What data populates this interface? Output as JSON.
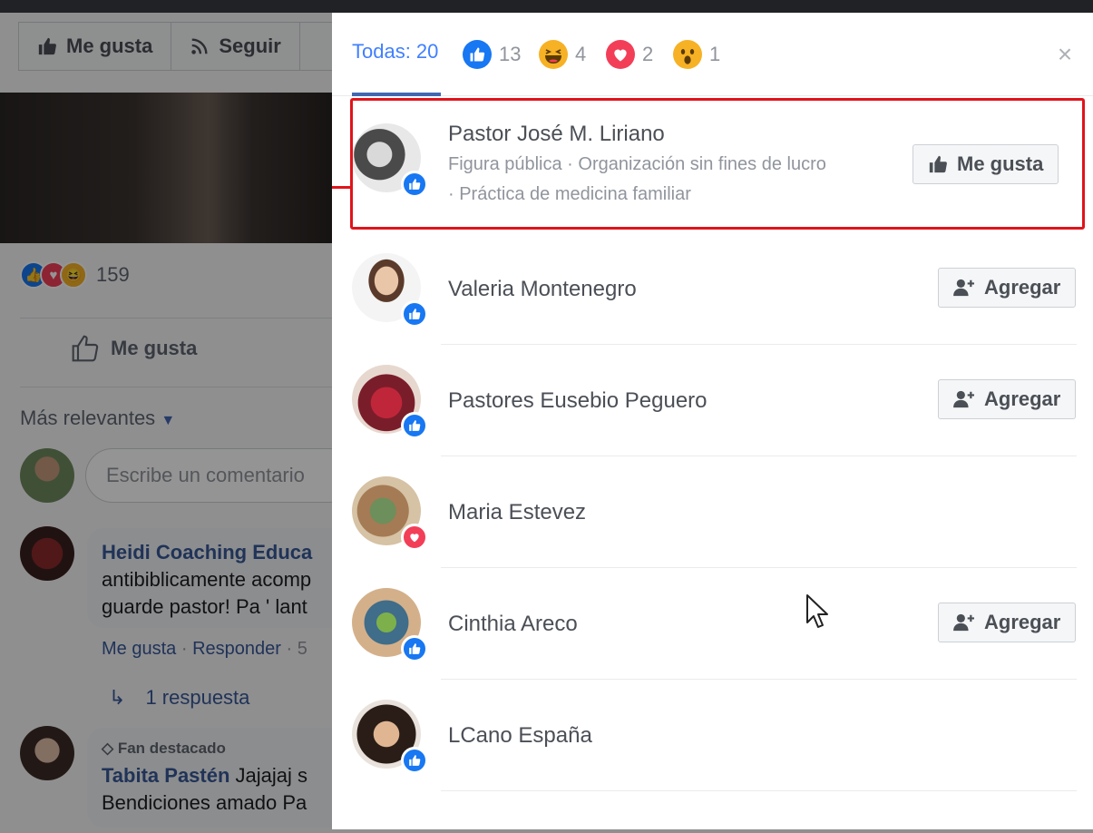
{
  "background": {
    "action_bar": {
      "like_label": "Me gusta",
      "follow_label": "Seguir"
    },
    "reactions_count": "159",
    "like_label": "Me gusta",
    "sort_label": "Más relevantes",
    "comment_placeholder": "Escribe un comentario",
    "comments": [
      {
        "author": "Heidi Coaching Educa",
        "line1": "antibiblicamente acomp",
        "line2": "guarde pastor! Pa ' lant"
      },
      {
        "badge": "Fan destacado",
        "author": "Tabita Pastén",
        "text": "Jajajaj s",
        "line2": "Bendiciones amado Pa"
      }
    ],
    "comment_actions": {
      "like": "Me gusta",
      "reply": "Responder",
      "sep": "·",
      "time": "5"
    },
    "replies_label": "1 respuesta"
  },
  "dialog": {
    "tabs": [
      {
        "label": "Todas: 20",
        "type": "all"
      },
      {
        "count": "13",
        "type": "like"
      },
      {
        "count": "4",
        "type": "haha"
      },
      {
        "count": "2",
        "type": "love"
      },
      {
        "count": "1",
        "type": "wow"
      }
    ],
    "close_label": "×",
    "people": [
      {
        "name": "Pastor José M. Liriano",
        "subtitle_1": "Figura pública · Organización sin fines de lucro",
        "subtitle_2": "· Práctica de medicina familiar",
        "reaction": "like",
        "action": "Me gusta"
      },
      {
        "name": "Valeria Montenegro",
        "reaction": "like",
        "action": "Agregar"
      },
      {
        "name": "Pastores Eusebio Peguero",
        "reaction": "like",
        "action": "Agregar"
      },
      {
        "name": "Maria Estevez",
        "reaction": "love",
        "action": ""
      },
      {
        "name": "Cinthia Areco",
        "reaction": "like",
        "action": "Agregar"
      },
      {
        "name": "LCano España",
        "reaction": "like",
        "action": ""
      }
    ]
  },
  "colors": {
    "like": "#1877f2",
    "love": "#f33e58",
    "haha_wow": "#f7b125",
    "link": "#385898",
    "active_tab": "#4080ff",
    "highlight": "#e0141b"
  }
}
